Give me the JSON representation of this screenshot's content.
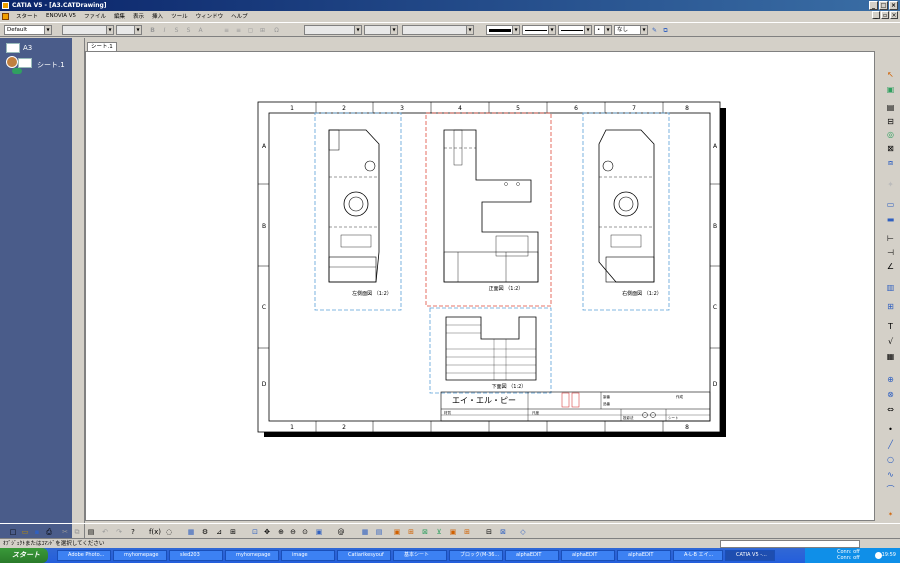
{
  "window": {
    "title": "CATIA V5 - [A3.CATDrawing]"
  },
  "menu": [
    "スタート",
    "ENOVIA V5",
    "ファイル",
    "編集",
    "表示",
    "挿入",
    "ツール",
    "ウィンドウ",
    "ヘルプ"
  ],
  "toolbar": {
    "style_combo": "Default",
    "pattern_combo": "なし"
  },
  "tree": {
    "root": "A3",
    "child": "シート.1"
  },
  "tabs": [
    "シート.1"
  ],
  "drawing": {
    "col_labels": [
      "1",
      "2",
      "3",
      "4",
      "5",
      "6",
      "7",
      "8"
    ],
    "row_labels": [
      "A",
      "B",
      "C",
      "D"
    ],
    "views": {
      "left_side": "左側面図 （1:2）",
      "front": "正面図 （1:2）",
      "right_side": "右側面図 （1:2）",
      "bottom": "下面図 （1:2）"
    },
    "title_block": {
      "company": "エイ・エル・ピー",
      "material_label": "材質",
      "item1": "製番",
      "item2": "品番",
      "scale_label": "尺度",
      "projection_label": "投影法",
      "sheet_label": "シート",
      "drawn_label": "作成"
    }
  },
  "status": {
    "text": "ｵﾌﾞｼﾞｪｸﾄまたはｺﾏﾝﾄﾞを選択してください"
  },
  "taskbar": {
    "start": "スタート",
    "tasks": [
      "Adobe Photo...",
      "myhomepage",
      "sled203",
      "myhomepage",
      "image",
      "Catiarikesyouf",
      "基本シート",
      "ブロック(M-36...",
      "alphaEDIT",
      "alphaEDIT",
      "alphaEDIT",
      "A-L-B エイ...",
      "CATIA V5 -..."
    ],
    "clock": "19:59",
    "tray_top": "Conn: off",
    "tray_bottom": "Conn: off"
  }
}
